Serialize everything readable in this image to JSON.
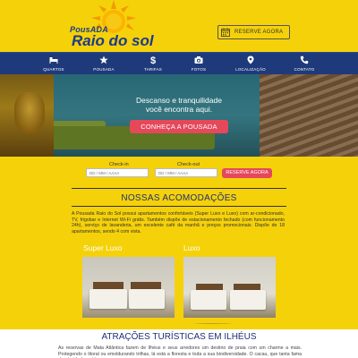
{
  "header": {
    "logo": {
      "line1": "PousADA",
      "line2": "Raio do sol"
    },
    "reserve_button": "RESERVE AGORA"
  },
  "nav": {
    "items": [
      {
        "label": "QUARTOS",
        "icon": "bed-icon"
      },
      {
        "label": "POUSADA",
        "icon": "star-icon"
      },
      {
        "label": "TARIFAS",
        "icon": "dollar-icon"
      },
      {
        "label": "FOTOS",
        "icon": "camera-icon"
      },
      {
        "label": "LOCALIZAÇÃO",
        "icon": "map-pin-icon"
      },
      {
        "label": "CONTATO",
        "icon": "phone-icon"
      }
    ]
  },
  "hero": {
    "line1": "Descanso e tranquilidade",
    "line2": "você encontra aqui.",
    "button": "CONHEÇA A POUSADA"
  },
  "booking": {
    "checkin_label": "Check-in",
    "checkin_placeholder": "DD / MM / AAAA",
    "checkout_label": "Check-out",
    "checkout_placeholder": "DD / MM / AAAA",
    "button": "RESERVE AGORA"
  },
  "rooms": {
    "title": "NOSSAS ACOMODAÇÕES",
    "description": "A Pousada Raio do Sol possui apartamentos confortáveis (Super Luxo e Luxo) com ar-condicionado, TV, frigobar e Internet Wi-Fi grátis. Também dispõe de estacionamento fechado (com funcionamento 24h), serviço de lavanderia, um excelente café da manhã e preços promocionais. Dispõe de 18 apartamentos, sendo 4 com vista.",
    "items": [
      {
        "title": "Super Luxo"
      },
      {
        "title": "Luxo"
      }
    ]
  },
  "attractions": {
    "title": "ATRAÇÕES TURÍSTICAS EM ILHÉUS",
    "description": "As reservas de Mata Atlântica fazem de Ilhéus e seus arredores um destino de praia com um charme a mais. Protegendo o litoral ou emoldurando trilhas, lá está a floresta e toda a sua biodiversidade. O cacau, que tanta fama deu à cidade, está"
  },
  "colors": {
    "yellow": "#f5d10a",
    "navy": "#1e3a7a",
    "accent": "#e5485a",
    "title_blue": "#1f2f7a"
  }
}
